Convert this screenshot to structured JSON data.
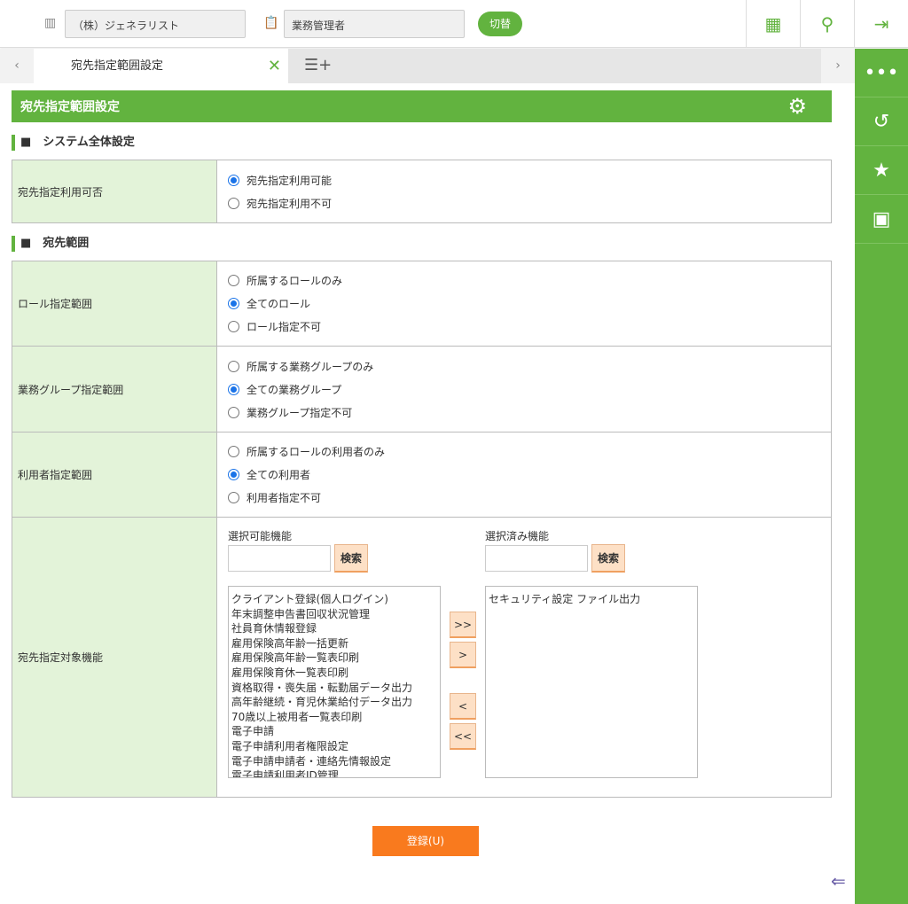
{
  "header": {
    "company": "（株）ジェネラリスト",
    "role": "業務管理者",
    "switch_label": "切替"
  },
  "tabs": {
    "active": "宛先指定範囲設定"
  },
  "page_title": "宛先指定範囲設定",
  "section1": {
    "title": "■　システム全体設定",
    "rows": [
      {
        "label": "宛先指定利用可否",
        "options": [
          "宛先指定利用可能",
          "宛先指定利用不可"
        ],
        "selected": 0
      }
    ]
  },
  "section2": {
    "title": "■　宛先範囲",
    "rows": [
      {
        "label": "ロール指定範囲",
        "options": [
          "所属するロールのみ",
          "全てのロール",
          "ロール指定不可"
        ],
        "selected": 1
      },
      {
        "label": "業務グループ指定範囲",
        "options": [
          "所属する業務グループのみ",
          "全ての業務グループ",
          "業務グループ指定不可"
        ],
        "selected": 1
      },
      {
        "label": "利用者指定範囲",
        "options": [
          "所属するロールの利用者のみ",
          "全ての利用者",
          "利用者指定不可"
        ],
        "selected": 1
      }
    ],
    "func_label": "宛先指定対象機能",
    "available_label": "選択可能機能",
    "selected_label": "選択済み機能",
    "search_label": "検索",
    "available": [
      "クライアント登録(個人ログイン)",
      "年末調整申告書回収状況管理",
      "社員育休情報登録",
      "雇用保険高年齢一括更新",
      "雇用保険高年齢一覧表印刷",
      "雇用保険育休一覧表印刷",
      "資格取得・喪失届・転勤届データ出力",
      "高年齢継続・育児休業給付データ出力",
      "70歳以上被用者一覧表印刷",
      "電子申請",
      "電子申請利用者権限設定",
      "電子申請申請者・連絡先情報設定",
      "電子申請利用者ID管理"
    ],
    "selected": [
      "セキュリティ設定 ファイル出力"
    ],
    "move_all_right": ">>",
    "move_right": ">",
    "move_left": "<",
    "move_all_left": "<<"
  },
  "register_label": "登録(U)"
}
